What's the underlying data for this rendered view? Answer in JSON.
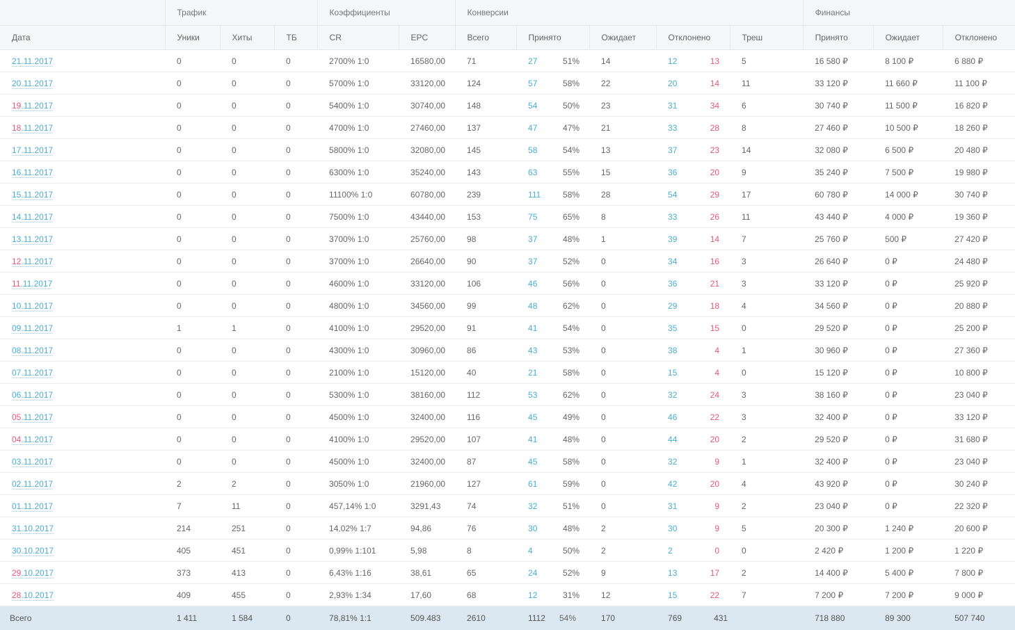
{
  "header": {
    "groups": {
      "traffic": "Трафик",
      "coefficients": "Коэффициенты",
      "conversions": "Конверсии",
      "finances": "Финансы"
    },
    "columns": {
      "date": "Дата",
      "uniques": "Уники",
      "hits": "Хиты",
      "tb": "ТБ",
      "cr": "CR",
      "epc": "EPC",
      "conv_total": "Всего",
      "conv_accepted": "Принято",
      "conv_pending": "Ожидает",
      "conv_rejected": "Отклонено",
      "conv_trash": "Треш",
      "fin_accepted": "Принято",
      "fin_pending": "Ожидает",
      "fin_rejected": "Отклонено"
    }
  },
  "rows": [
    {
      "dd": "21",
      "rest": ".11.2017",
      "weekend": false,
      "uniques": "0",
      "hits": "0",
      "tb": "0",
      "cr": "2700% 1:0",
      "epc": "16580,00",
      "total": "71",
      "accepted": "27",
      "acc_pct": "51%",
      "pending": "14",
      "rejected": "12",
      "rejected2": "13",
      "trash": "5",
      "fin_acc": "16 580 ₽",
      "fin_pend": "8 100 ₽",
      "fin_rej": "6 880 ₽"
    },
    {
      "dd": "20",
      "rest": ".11.2017",
      "weekend": false,
      "uniques": "0",
      "hits": "0",
      "tb": "0",
      "cr": "5700% 1:0",
      "epc": "33120,00",
      "total": "124",
      "accepted": "57",
      "acc_pct": "58%",
      "pending": "22",
      "rejected": "20",
      "rejected2": "14",
      "trash": "11",
      "fin_acc": "33 120 ₽",
      "fin_pend": "11 660 ₽",
      "fin_rej": "11 100 ₽"
    },
    {
      "dd": "19",
      "rest": ".11.2017",
      "weekend": true,
      "uniques": "0",
      "hits": "0",
      "tb": "0",
      "cr": "5400% 1:0",
      "epc": "30740,00",
      "total": "148",
      "accepted": "54",
      "acc_pct": "50%",
      "pending": "23",
      "rejected": "31",
      "rejected2": "34",
      "trash": "6",
      "fin_acc": "30 740 ₽",
      "fin_pend": "11 500 ₽",
      "fin_rej": "16 820 ₽"
    },
    {
      "dd": "18",
      "rest": ".11.2017",
      "weekend": true,
      "uniques": "0",
      "hits": "0",
      "tb": "0",
      "cr": "4700% 1:0",
      "epc": "27460,00",
      "total": "137",
      "accepted": "47",
      "acc_pct": "47%",
      "pending": "21",
      "rejected": "33",
      "rejected2": "28",
      "trash": "8",
      "fin_acc": "27 460 ₽",
      "fin_pend": "10 500 ₽",
      "fin_rej": "18 260 ₽"
    },
    {
      "dd": "17",
      "rest": ".11.2017",
      "weekend": false,
      "uniques": "0",
      "hits": "0",
      "tb": "0",
      "cr": "5800% 1:0",
      "epc": "32080,00",
      "total": "145",
      "accepted": "58",
      "acc_pct": "54%",
      "pending": "13",
      "rejected": "37",
      "rejected2": "23",
      "trash": "14",
      "fin_acc": "32 080 ₽",
      "fin_pend": "6 500 ₽",
      "fin_rej": "20 480 ₽"
    },
    {
      "dd": "16",
      "rest": ".11.2017",
      "weekend": false,
      "uniques": "0",
      "hits": "0",
      "tb": "0",
      "cr": "6300% 1:0",
      "epc": "35240,00",
      "total": "143",
      "accepted": "63",
      "acc_pct": "55%",
      "pending": "15",
      "rejected": "36",
      "rejected2": "20",
      "trash": "9",
      "fin_acc": "35 240 ₽",
      "fin_pend": "7 500 ₽",
      "fin_rej": "19 980 ₽"
    },
    {
      "dd": "15",
      "rest": ".11.2017",
      "weekend": false,
      "uniques": "0",
      "hits": "0",
      "tb": "0",
      "cr": "11100% 1:0",
      "epc": "60780,00",
      "total": "239",
      "accepted": "111",
      "acc_pct": "58%",
      "pending": "28",
      "rejected": "54",
      "rejected2": "29",
      "trash": "17",
      "fin_acc": "60 780 ₽",
      "fin_pend": "14 000 ₽",
      "fin_rej": "30 740 ₽"
    },
    {
      "dd": "14",
      "rest": ".11.2017",
      "weekend": false,
      "uniques": "0",
      "hits": "0",
      "tb": "0",
      "cr": "7500% 1:0",
      "epc": "43440,00",
      "total": "153",
      "accepted": "75",
      "acc_pct": "65%",
      "pending": "8",
      "rejected": "33",
      "rejected2": "26",
      "trash": "11",
      "fin_acc": "43 440 ₽",
      "fin_pend": "4 000 ₽",
      "fin_rej": "19 360 ₽"
    },
    {
      "dd": "13",
      "rest": ".11.2017",
      "weekend": false,
      "uniques": "0",
      "hits": "0",
      "tb": "0",
      "cr": "3700% 1:0",
      "epc": "25760,00",
      "total": "98",
      "accepted": "37",
      "acc_pct": "48%",
      "pending": "1",
      "rejected": "39",
      "rejected2": "14",
      "trash": "7",
      "fin_acc": "25 760 ₽",
      "fin_pend": "500 ₽",
      "fin_rej": "27 420 ₽"
    },
    {
      "dd": "12",
      "rest": ".11.2017",
      "weekend": true,
      "uniques": "0",
      "hits": "0",
      "tb": "0",
      "cr": "3700% 1:0",
      "epc": "26640,00",
      "total": "90",
      "accepted": "37",
      "acc_pct": "52%",
      "pending": "0",
      "rejected": "34",
      "rejected2": "16",
      "trash": "3",
      "fin_acc": "26 640 ₽",
      "fin_pend": "0 ₽",
      "fin_rej": "24 480 ₽"
    },
    {
      "dd": "11",
      "rest": ".11.2017",
      "weekend": true,
      "uniques": "0",
      "hits": "0",
      "tb": "0",
      "cr": "4600% 1:0",
      "epc": "33120,00",
      "total": "106",
      "accepted": "46",
      "acc_pct": "56%",
      "pending": "0",
      "rejected": "36",
      "rejected2": "21",
      "trash": "3",
      "fin_acc": "33 120 ₽",
      "fin_pend": "0 ₽",
      "fin_rej": "25 920 ₽"
    },
    {
      "dd": "10",
      "rest": ".11.2017",
      "weekend": false,
      "uniques": "0",
      "hits": "0",
      "tb": "0",
      "cr": "4800% 1:0",
      "epc": "34560,00",
      "total": "99",
      "accepted": "48",
      "acc_pct": "62%",
      "pending": "0",
      "rejected": "29",
      "rejected2": "18",
      "trash": "4",
      "fin_acc": "34 560 ₽",
      "fin_pend": "0 ₽",
      "fin_rej": "20 880 ₽"
    },
    {
      "dd": "09",
      "rest": ".11.2017",
      "weekend": false,
      "uniques": "1",
      "hits": "1",
      "tb": "0",
      "cr": "4100% 1:0",
      "epc": "29520,00",
      "total": "91",
      "accepted": "41",
      "acc_pct": "54%",
      "pending": "0",
      "rejected": "35",
      "rejected2": "15",
      "trash": "0",
      "fin_acc": "29 520 ₽",
      "fin_pend": "0 ₽",
      "fin_rej": "25 200 ₽"
    },
    {
      "dd": "08",
      "rest": ".11.2017",
      "weekend": false,
      "uniques": "0",
      "hits": "0",
      "tb": "0",
      "cr": "4300% 1:0",
      "epc": "30960,00",
      "total": "86",
      "accepted": "43",
      "acc_pct": "53%",
      "pending": "0",
      "rejected": "38",
      "rejected2": "4",
      "trash": "1",
      "fin_acc": "30 960 ₽",
      "fin_pend": "0 ₽",
      "fin_rej": "27 360 ₽"
    },
    {
      "dd": "07",
      "rest": ".11.2017",
      "weekend": false,
      "uniques": "0",
      "hits": "0",
      "tb": "0",
      "cr": "2100% 1:0",
      "epc": "15120,00",
      "total": "40",
      "accepted": "21",
      "acc_pct": "58%",
      "pending": "0",
      "rejected": "15",
      "rejected2": "4",
      "trash": "0",
      "fin_acc": "15 120 ₽",
      "fin_pend": "0 ₽",
      "fin_rej": "10 800 ₽"
    },
    {
      "dd": "06",
      "rest": ".11.2017",
      "weekend": false,
      "uniques": "0",
      "hits": "0",
      "tb": "0",
      "cr": "5300% 1:0",
      "epc": "38160,00",
      "total": "112",
      "accepted": "53",
      "acc_pct": "62%",
      "pending": "0",
      "rejected": "32",
      "rejected2": "24",
      "trash": "3",
      "fin_acc": "38 160 ₽",
      "fin_pend": "0 ₽",
      "fin_rej": "23 040 ₽"
    },
    {
      "dd": "05",
      "rest": ".11.2017",
      "weekend": true,
      "uniques": "0",
      "hits": "0",
      "tb": "0",
      "cr": "4500% 1:0",
      "epc": "32400,00",
      "total": "116",
      "accepted": "45",
      "acc_pct": "49%",
      "pending": "0",
      "rejected": "46",
      "rejected2": "22",
      "trash": "3",
      "fin_acc": "32 400 ₽",
      "fin_pend": "0 ₽",
      "fin_rej": "33 120 ₽"
    },
    {
      "dd": "04",
      "rest": ".11.2017",
      "weekend": true,
      "uniques": "0",
      "hits": "0",
      "tb": "0",
      "cr": "4100% 1:0",
      "epc": "29520,00",
      "total": "107",
      "accepted": "41",
      "acc_pct": "48%",
      "pending": "0",
      "rejected": "44",
      "rejected2": "20",
      "trash": "2",
      "fin_acc": "29 520 ₽",
      "fin_pend": "0 ₽",
      "fin_rej": "31 680 ₽"
    },
    {
      "dd": "03",
      "rest": ".11.2017",
      "weekend": false,
      "uniques": "0",
      "hits": "0",
      "tb": "0",
      "cr": "4500% 1:0",
      "epc": "32400,00",
      "total": "87",
      "accepted": "45",
      "acc_pct": "58%",
      "pending": "0",
      "rejected": "32",
      "rejected2": "9",
      "trash": "1",
      "fin_acc": "32 400 ₽",
      "fin_pend": "0 ₽",
      "fin_rej": "23 040 ₽"
    },
    {
      "dd": "02",
      "rest": ".11.2017",
      "weekend": false,
      "uniques": "2",
      "hits": "2",
      "tb": "0",
      "cr": "3050% 1:0",
      "epc": "21960,00",
      "total": "127",
      "accepted": "61",
      "acc_pct": "59%",
      "pending": "0",
      "rejected": "42",
      "rejected2": "20",
      "trash": "4",
      "fin_acc": "43 920 ₽",
      "fin_pend": "0 ₽",
      "fin_rej": "30 240 ₽"
    },
    {
      "dd": "01",
      "rest": ".11.2017",
      "weekend": false,
      "uniques": "7",
      "hits": "11",
      "tb": "0",
      "cr": "457,14% 1:0",
      "epc": "3291,43",
      "total": "74",
      "accepted": "32",
      "acc_pct": "51%",
      "pending": "0",
      "rejected": "31",
      "rejected2": "9",
      "trash": "2",
      "fin_acc": "23 040 ₽",
      "fin_pend": "0 ₽",
      "fin_rej": "22 320 ₽"
    },
    {
      "dd": "31",
      "rest": ".10.2017",
      "weekend": false,
      "uniques": "214",
      "hits": "251",
      "tb": "0",
      "cr": "14,02% 1:7",
      "epc": "94,86",
      "total": "76",
      "accepted": "30",
      "acc_pct": "48%",
      "pending": "2",
      "rejected": "30",
      "rejected2": "9",
      "trash": "5",
      "fin_acc": "20 300 ₽",
      "fin_pend": "1 240 ₽",
      "fin_rej": "20 600 ₽"
    },
    {
      "dd": "30",
      "rest": ".10.2017",
      "weekend": false,
      "uniques": "405",
      "hits": "451",
      "tb": "0",
      "cr": "0,99% 1:101",
      "epc": "5,98",
      "total": "8",
      "accepted": "4",
      "acc_pct": "50%",
      "pending": "2",
      "rejected": "2",
      "rejected2": "0",
      "trash": "0",
      "fin_acc": "2 420 ₽",
      "fin_pend": "1 200 ₽",
      "fin_rej": "1 220 ₽"
    },
    {
      "dd": "29",
      "rest": ".10.2017",
      "weekend": true,
      "uniques": "373",
      "hits": "413",
      "tb": "0",
      "cr": "6,43% 1:16",
      "epc": "38,61",
      "total": "65",
      "accepted": "24",
      "acc_pct": "52%",
      "pending": "9",
      "rejected": "13",
      "rejected2": "17",
      "trash": "2",
      "fin_acc": "14 400 ₽",
      "fin_pend": "5 400 ₽",
      "fin_rej": "7 800 ₽"
    },
    {
      "dd": "28",
      "rest": ".10.2017",
      "weekend": true,
      "uniques": "409",
      "hits": "455",
      "tb": "0",
      "cr": "2,93% 1:34",
      "epc": "17,60",
      "total": "68",
      "accepted": "12",
      "acc_pct": "31%",
      "pending": "12",
      "rejected": "15",
      "rejected2": "22",
      "trash": "7",
      "fin_acc": "7 200 ₽",
      "fin_pend": "7 200 ₽",
      "fin_rej": "9 000 ₽"
    }
  ],
  "totals": {
    "label": "Всего",
    "uniques": "1 411",
    "hits": "1 584",
    "tb": "0",
    "cr": "78,81% 1:1",
    "epc": "509.483",
    "total": "2610",
    "accepted": "1112",
    "acc_pct": "54%",
    "pending": "170",
    "rejected": "769",
    "rejected2": "431",
    "trash": "",
    "fin_acc": "718 880",
    "fin_pend": "89 300",
    "fin_rej": "507 740"
  },
  "colors": {
    "link": "#4aaed4",
    "weekend": "#e05a7a",
    "header_bg": "#f5f6f8",
    "total_bg": "#dbe8f2"
  }
}
